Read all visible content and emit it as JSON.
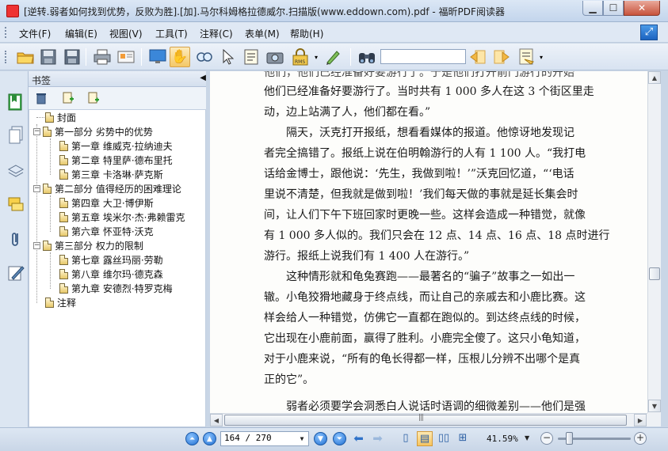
{
  "window": {
    "title": "[逆转.弱者如何找到优势，反败为胜].[加].马尔科姆格拉德威尔.扫描版(www.eddown.com).pdf - 福昕PDF阅读器",
    "minimize": "▁",
    "maximize": "☐",
    "close": "✕"
  },
  "menu": {
    "file": "文件(F)",
    "edit": "编辑(E)",
    "view": "视图(V)",
    "tools": "工具(T)",
    "comment": "注释(C)",
    "form": "表单(M)",
    "help": "帮助(H)"
  },
  "toolbar": {
    "find_value": "",
    "icons": [
      "open-folder-icon",
      "save-icon",
      "save-as-icon",
      "print-icon",
      "scan-icon",
      "monitor-icon",
      "hand-tool-icon",
      "magnifier-icon",
      "select-arrow-icon",
      "text-select-icon",
      "snapshot-icon",
      "security-icon",
      "typewriter-icon",
      "binoculars-icon",
      "find-prev-icon",
      "find-next-icon",
      "highlight-icon"
    ]
  },
  "bookmarks": {
    "header": "书签",
    "items": [
      {
        "label": "封面",
        "level": 1
      },
      {
        "label": "第一部分 劣势中的优势",
        "level": 1
      },
      {
        "label": "第一章 维威克·拉纳迪夫",
        "level": 2
      },
      {
        "label": "第二章 特里萨·德布里托",
        "level": 2
      },
      {
        "label": "第三章 卡洛琳·萨克斯",
        "level": 2
      },
      {
        "label": "第二部分 值得经历的困难理论",
        "level": 1
      },
      {
        "label": "第四章 大卫·博伊斯",
        "level": 2
      },
      {
        "label": "第五章 埃米尔·杰·弗赖雷克",
        "level": 2
      },
      {
        "label": "第六章 怀亚特·沃克",
        "level": 2
      },
      {
        "label": "第三部分 权力的限制",
        "level": 1
      },
      {
        "label": "第七章 露丝玛丽·劳勒",
        "level": 2
      },
      {
        "label": "第八章 维尔玛·德克森",
        "level": 2
      },
      {
        "label": "第九章 安德烈·特罗克梅",
        "level": 2
      },
      {
        "label": "注释",
        "level": 1
      }
    ]
  },
  "document": {
    "lines": [
      "他们已经准备好要游行了。当时共有 1 000 多人在这 3 个街区里走",
      "动，边上站满了人，他们都在看。”",
      "隔天，沃克打开报纸，想看看媒体的报道。他惊讶地发现记",
      "者完全搞错了。报纸上说在伯明翰游行的人有 1 100 人。“我打电",
      "话给金博士，跟他说：‘先生，我做到啦！’”沃克回忆道，“‘电话",
      "里说不清楚，但我就是做到啦！’我们每天做的事就是延长集会时",
      "间，让人们下午下班回家时更晚一些。这样会造成一种错觉，就像",
      "有 1 000 多人似的。我们只会在 12 点、14 点、16 点、18 点时进行",
      "游行。报纸上说我们有 1 400 人在游行。”",
      "这种情形就和龟兔赛跑——最著名的“骗子”故事之一如出一",
      "辙。小龟狡猾地藏身于终点线，而让自己的亲戚去和小鹿比赛。这",
      "样会给人一种错觉，仿佛它一直都在跑似的。到达终点线的时候，",
      "它出现在小鹿前面，赢得了胜利。小鹿完全傻了。这只小龟知道，",
      "对于小鹿来说，“所有的龟长得都一样，压根儿分辨不出哪个是真",
      "正的它”。",
      "弱者必须要学会洞悉白人说话时语调的细微差别——他们是强"
    ],
    "top_partial": "他们，他们已经准备好要游行了。于是他们打开前门游行的开始"
  },
  "status": {
    "page_value": "164 / 270",
    "zoom": "41.59%",
    "zoom_level": 0.12
  }
}
